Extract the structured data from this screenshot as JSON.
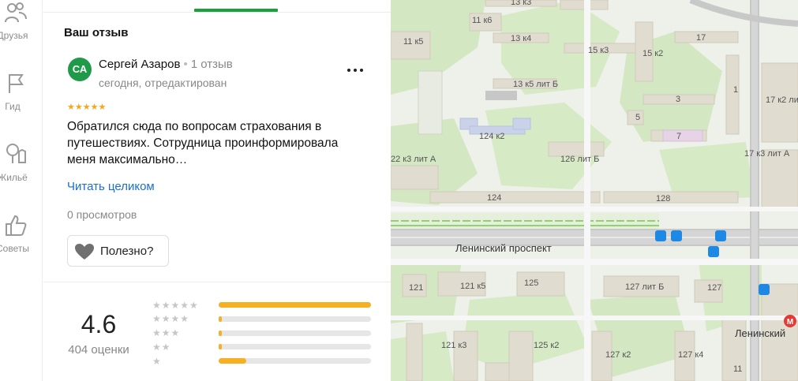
{
  "nav": {
    "items": [
      {
        "label": "Друзья",
        "icon": "friends-icon"
      },
      {
        "label": "Гид",
        "icon": "flag-icon"
      },
      {
        "label": "Жильё",
        "icon": "housing-icon"
      },
      {
        "label": "Советы",
        "icon": "thumbs-up-icon"
      }
    ]
  },
  "review": {
    "section_title": "Ваш отзыв",
    "avatar_initials": "СА",
    "author_name": "Сергей Азаров",
    "author_review_count": "1 отзыв",
    "date": "сегодня, отредактирован",
    "stars": "★★★★★",
    "rating": 5,
    "text": "Обратился сюда по вопросам страхования в путешествиях. Сотрудница проинформировала меня максимально…",
    "read_more": "Читать целиком",
    "views": "0 просмотров",
    "useful_label": "Полезно?"
  },
  "summary": {
    "average": "4.6",
    "ratings_count": "404 оценки",
    "distribution": [
      {
        "stars": "★★★★★",
        "share": 1.0
      },
      {
        "stars": "★★★★",
        "share": 0.01
      },
      {
        "stars": "★★★",
        "share": 0.02
      },
      {
        "stars": "★★",
        "share": 0.01
      },
      {
        "stars": "★",
        "share": 0.18
      }
    ]
  },
  "map": {
    "street": "Ленинский проспект",
    "metro": "Ленинский",
    "buildings": [
      "13 к3",
      "11 к6",
      "13 к4",
      "11 к5",
      "15 к3",
      "15 к2",
      "17",
      "13 к5 лит Б",
      "1",
      "3",
      "17 к2 лит",
      "5",
      "124 к2",
      "7",
      "22 к3 лит А",
      "126 лит Б",
      "17 к3 лит А",
      "124",
      "128",
      "121",
      "121 к5",
      "125",
      "127 лит Б",
      "127",
      "121 к3",
      "125 к2",
      "127 к2",
      "127 к4",
      "11"
    ]
  }
}
